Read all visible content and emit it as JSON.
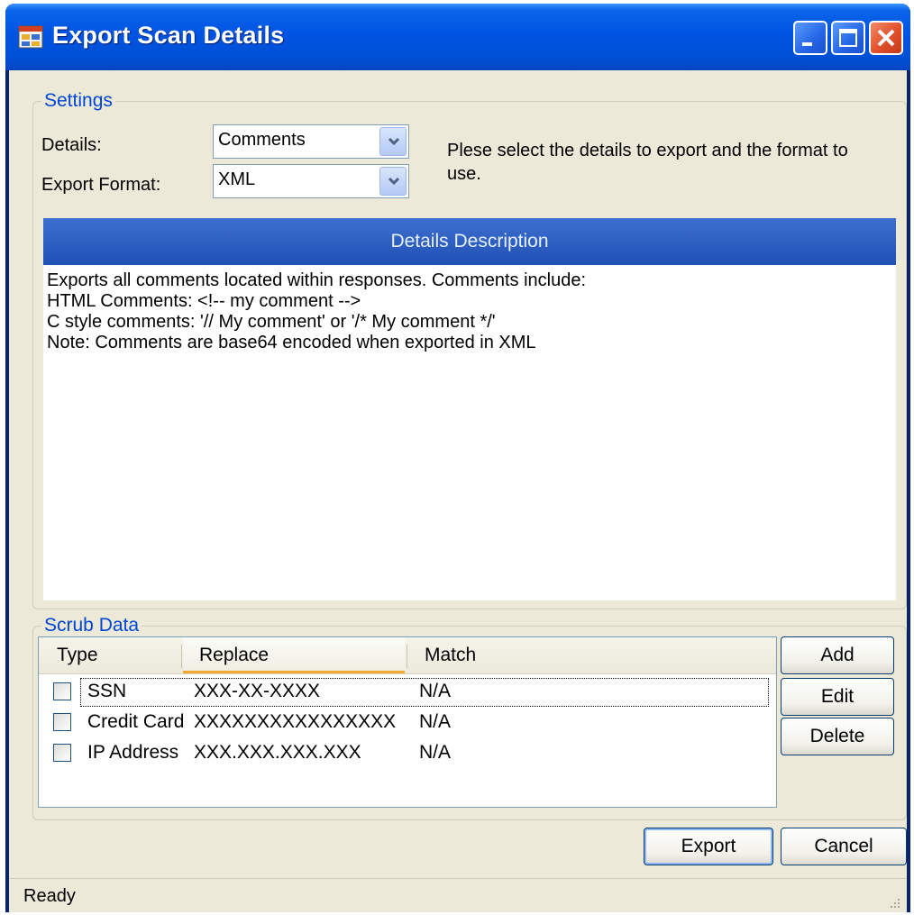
{
  "window": {
    "title": "Export Scan Details"
  },
  "settings": {
    "legend": "Settings",
    "details_label": "Details:",
    "details_value": "Comments",
    "format_label": "Export Format:",
    "format_value": "XML",
    "instructions": "Plese select the details to export and the format to use."
  },
  "description": {
    "header": "Details Description",
    "text": "Exports all comments located within responses. Comments include:\nHTML Comments: <!-- my comment -->\nC style comments: '// My comment' or '/* My comment */'\nNote: Comments are base64 encoded when exported in XML"
  },
  "scrub": {
    "legend": "Scrub Data",
    "columns": [
      "Type",
      "Replace",
      "Match"
    ],
    "rows": [
      {
        "type": "SSN",
        "replace": "XXX-XX-XXXX",
        "match": "N/A",
        "checked": false
      },
      {
        "type": "Credit Card",
        "replace": "XXXXXXXXXXXXXXXX",
        "match": "N/A",
        "checked": false
      },
      {
        "type": "IP Address",
        "replace": "XXX.XXX.XXX.XXX",
        "match": "N/A",
        "checked": false
      }
    ],
    "add_label": "Add",
    "edit_label": "Edit",
    "delete_label": "Delete"
  },
  "actions": {
    "export_label": "Export",
    "cancel_label": "Cancel"
  },
  "status": {
    "text": "Ready"
  },
  "colors": {
    "titlebar": "#0054e3",
    "dialog_bg": "#ece9d8",
    "header_blue": "#2a5bbf",
    "legend_blue": "#0046d5"
  }
}
